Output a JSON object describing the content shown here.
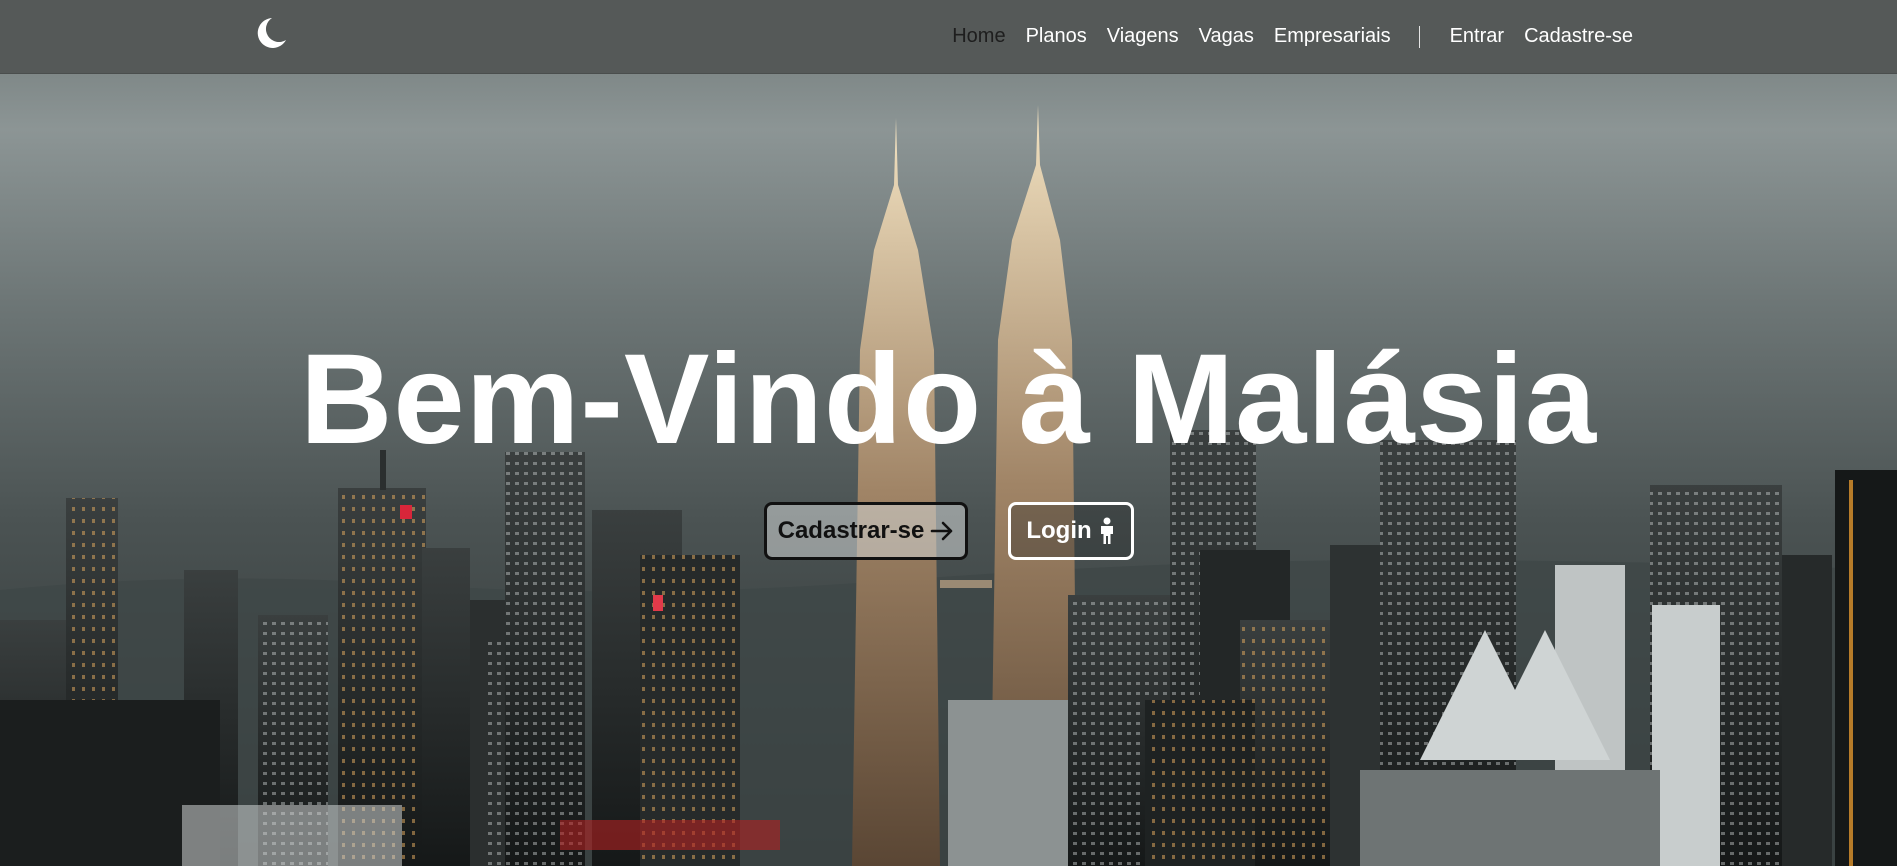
{
  "nav": {
    "logo_icon": "crescent-moon-icon",
    "links": [
      {
        "label": "Home",
        "active": true
      },
      {
        "label": "Planos",
        "active": false
      },
      {
        "label": "Viagens",
        "active": false
      },
      {
        "label": "Vagas",
        "active": false
      },
      {
        "label": "Empresariais",
        "active": false
      }
    ],
    "auth": {
      "login_label": "Entrar",
      "signup_label": "Cadastre-se"
    }
  },
  "hero": {
    "title": "Bem-Vindo à Malásia",
    "background": "kuala-lumpur-skyline-petronas-towers",
    "signup_button": {
      "label": "Cadastrar-se",
      "icon": "arrow-right-icon"
    },
    "login_button": {
      "label": "Login",
      "icon": "person-icon"
    }
  },
  "colors": {
    "navbar": "#555958",
    "active_link": "#1e1e1e",
    "text": "#ffffff"
  }
}
